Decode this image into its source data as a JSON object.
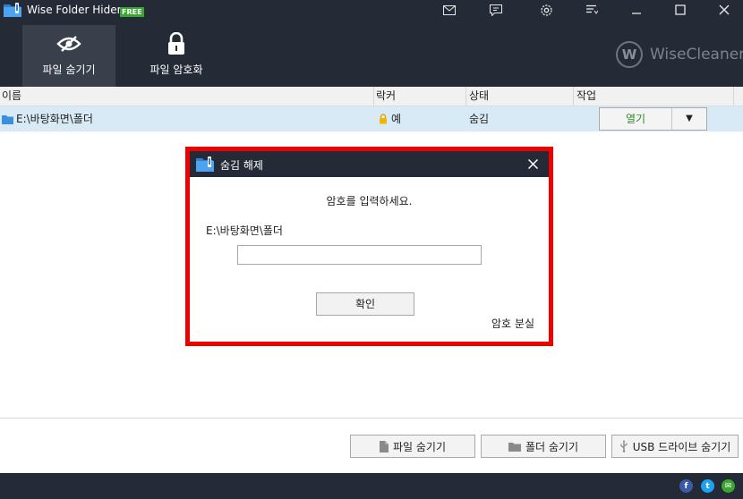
{
  "window": {
    "title": "Wise Folder Hider",
    "badge": "FREE",
    "titlebar_icons": [
      "mail-icon",
      "feedback-icon",
      "settings-icon",
      "menu-icon",
      "minimize-icon",
      "maximize-icon",
      "close-icon"
    ]
  },
  "nav": {
    "tabs": [
      {
        "label": "파일 숨기기",
        "icon": "eye-slash-icon",
        "active": true
      },
      {
        "label": "파일 암호화",
        "icon": "lock-icon",
        "active": false
      }
    ]
  },
  "brand": {
    "mark": "W",
    "name": "WiseCleaner"
  },
  "table": {
    "columns": [
      "이름",
      "락커",
      "상태",
      "작업"
    ],
    "rows": [
      {
        "name": "E:\\바탕화면\\폴더",
        "locker": "예",
        "status": "숨김",
        "action": "열기",
        "action_dropdown": "▼"
      }
    ]
  },
  "dialog": {
    "title": "숨김 해제",
    "prompt": "암호를 입력하세요.",
    "path": "E:\\바탕화면\\폴더",
    "password_value": "",
    "ok_label": "확인",
    "forgot_label": "암호 분실"
  },
  "bottom_buttons": [
    {
      "label": "파일 숨기기",
      "icon": "file-icon"
    },
    {
      "label": "폴더 숨기기",
      "icon": "folder-icon"
    },
    {
      "label": "USB 드라이브 숨기기",
      "icon": "usb-icon"
    }
  ],
  "social": {
    "facebook": "f",
    "twitter": "t",
    "email": "✉"
  },
  "colors": {
    "header_bg": "#252b36",
    "active_tab_bg": "#3a404b",
    "row_selected_bg": "#d9eaf7",
    "highlight_border": "#ee0000",
    "open_text": "#2a8a2a",
    "free_badge": "#3aa62f"
  }
}
